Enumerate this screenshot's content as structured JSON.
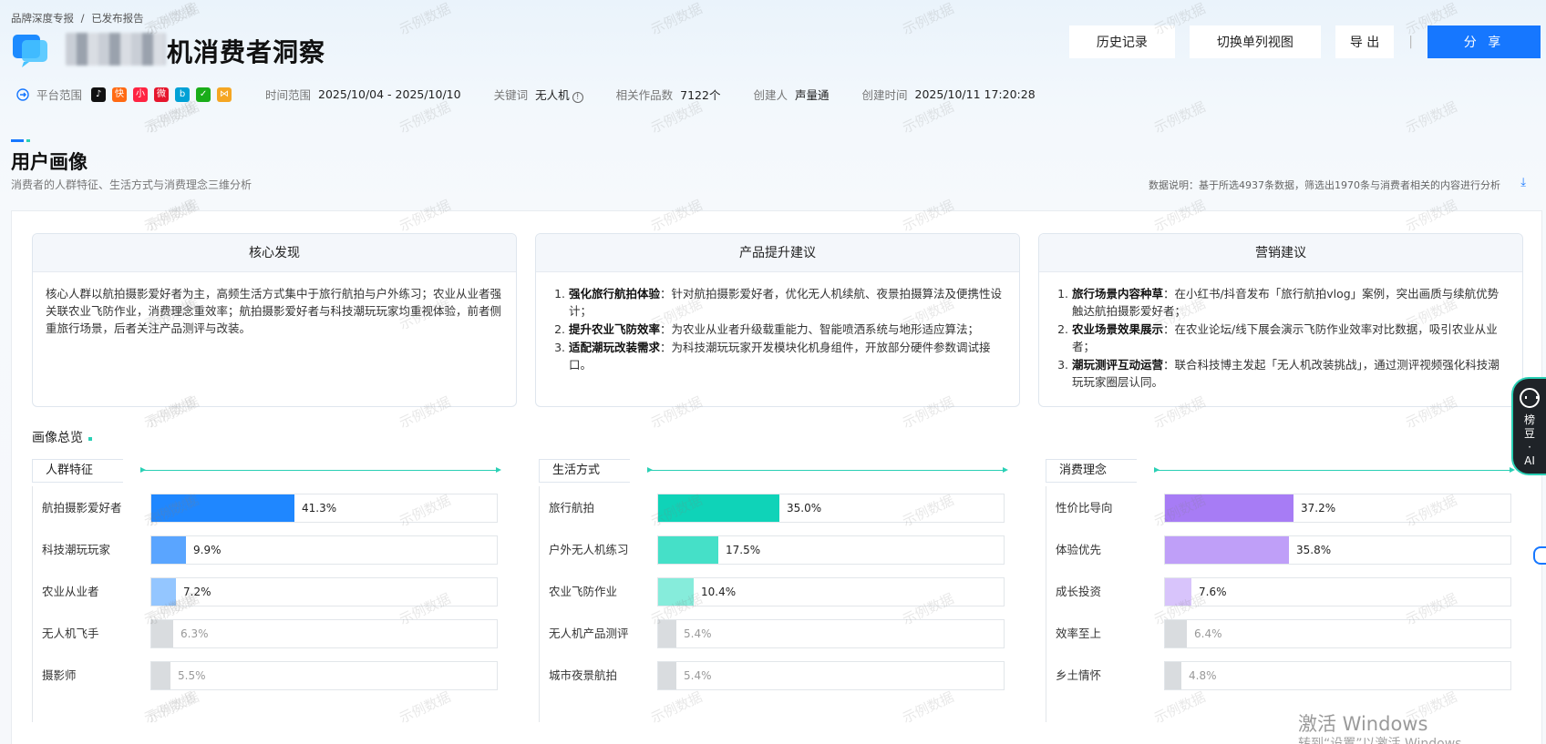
{
  "breadcrumb": [
    "品牌深度专报",
    "/",
    "已发布报告"
  ],
  "title": "机消费者洞察",
  "actions": {
    "history": "历史记录",
    "single_view": "切换单列视图",
    "export": "导 出",
    "sep": "|",
    "share": "分 享"
  },
  "meta": {
    "platform_label": "平台范围",
    "platform_icons": [
      {
        "name": "douyin-icon",
        "color": "#111111",
        "glyph": "♪"
      },
      {
        "name": "kuaishou-icon",
        "color": "#ff6a13",
        "glyph": "快"
      },
      {
        "name": "xiaohongshu-icon",
        "color": "#ff2442",
        "glyph": "小"
      },
      {
        "name": "weibo-icon",
        "color": "#e6162d",
        "glyph": "微"
      },
      {
        "name": "bilibili-icon",
        "color": "#00a1d6",
        "glyph": "b"
      },
      {
        "name": "wechat-icon",
        "color": "#1aad19",
        "glyph": "✓"
      },
      {
        "name": "toutiao-icon",
        "color": "#f5a623",
        "glyph": "⋈"
      }
    ],
    "time_label": "时间范围",
    "time_value": "2025/10/04 - 2025/10/10",
    "keyword_label": "关键词",
    "keyword_value": "无人机",
    "works_label": "相关作品数",
    "works_value": "7122个",
    "creator_label": "创建人",
    "creator_value": "声量通",
    "created_label": "创建时间",
    "created_value": "2025/10/11 17:20:28"
  },
  "section": {
    "title": "用户画像",
    "subtitle": "消费者的人群特征、生活方式与消费理念三维分析",
    "note": "数据说明：基于所选4937条数据，筛选出1970条与消费者相关的内容进行分析"
  },
  "cards": {
    "core": {
      "title": "核心发现",
      "text": "核心人群以航拍摄影爱好者为主，高频生活方式集中于旅行航拍与户外练习；农业从业者强关联农业飞防作业，消费理念重效率；航拍摄影爱好者与科技潮玩玩家均重视体验，前者侧重旅行场景，后者关注产品测评与改装。"
    },
    "product": {
      "title": "产品提升建议",
      "items": [
        {
          "head": "强化旅行航拍体验",
          "body": "：针对航拍摄影爱好者，优化无人机续航、夜景拍摄算法及便携性设计；"
        },
        {
          "head": "提升农业飞防效率",
          "body": "：为农业从业者升级载重能力、智能喷洒系统与地形适应算法；"
        },
        {
          "head": "适配潮玩改装需求",
          "body": "：为科技潮玩玩家开发模块化机身组件，开放部分硬件参数调试接口。"
        }
      ]
    },
    "marketing": {
      "title": "营销建议",
      "items": [
        {
          "head": "旅行场景内容种草",
          "body": "：在小红书/抖音发布「旅行航拍vlog」案例，突出画质与续航优势触达航拍摄影爱好者；"
        },
        {
          "head": "农业场景效果展示",
          "body": "：在农业论坛/线下展会演示飞防作业效率对比数据，吸引农业从业者；"
        },
        {
          "head": "潮玩测评互动运营",
          "body": "：联合科技博主发起「无人机改装挑战」，通过测评视频强化科技潮玩玩家圈层认同。"
        }
      ]
    }
  },
  "overview_title": "画像总览",
  "groups": [
    {
      "tag": "人群特征",
      "rows": [
        {
          "label": "航拍摄影爱好者",
          "value": 41.3,
          "text": "41.3%",
          "color": "#1f87ff"
        },
        {
          "label": "科技潮玩玩家",
          "value": 9.9,
          "text": "9.9%",
          "color": "#5aa5ff"
        },
        {
          "label": "农业从业者",
          "value": 7.2,
          "text": "7.2%",
          "color": "#94c6ff"
        },
        {
          "label": "无人机飞手",
          "value": 6.3,
          "text": "6.3%",
          "color": "#d9dcdf"
        },
        {
          "label": "摄影师",
          "value": 5.5,
          "text": "5.5%",
          "color": "#d9dcdf"
        }
      ]
    },
    {
      "tag": "生活方式",
      "rows": [
        {
          "label": "旅行航拍",
          "value": 35.0,
          "text": "35.0%",
          "color": "#0fd3b8"
        },
        {
          "label": "户外无人机练习",
          "value": 17.5,
          "text": "17.5%",
          "color": "#45e0c8"
        },
        {
          "label": "农业飞防作业",
          "value": 10.4,
          "text": "10.4%",
          "color": "#86ecdb"
        },
        {
          "label": "无人机产品测评",
          "value": 5.4,
          "text": "5.4%",
          "color": "#d9dcdf"
        },
        {
          "label": "城市夜景航拍",
          "value": 5.4,
          "text": "5.4%",
          "color": "#d9dcdf"
        }
      ]
    },
    {
      "tag": "消费理念",
      "rows": [
        {
          "label": "性价比导向",
          "value": 37.2,
          "text": "37.2%",
          "color": "#a77cf5"
        },
        {
          "label": "体验优先",
          "value": 35.8,
          "text": "35.8%",
          "color": "#bf9ff8"
        },
        {
          "label": "成长投资",
          "value": 7.6,
          "text": "7.6%",
          "color": "#d8c4fb"
        },
        {
          "label": "效率至上",
          "value": 6.4,
          "text": "6.4%",
          "color": "#d9dcdf"
        },
        {
          "label": "乡土情怀",
          "value": 4.8,
          "text": "4.8%",
          "color": "#d9dcdf"
        }
      ]
    }
  ],
  "ai_float": [
    "榜",
    "豆",
    "·",
    "AI"
  ],
  "watermark": "示例数据",
  "windows": {
    "line1": "激活 Windows",
    "line2": "转到“设置”以激活 Windows。"
  }
}
